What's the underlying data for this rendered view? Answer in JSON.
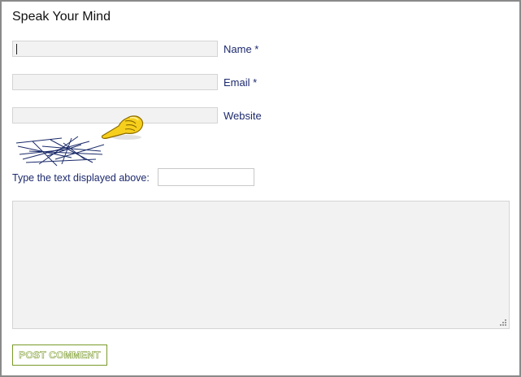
{
  "form": {
    "title": "Speak Your Mind",
    "fields": [
      {
        "label": "Name *",
        "value": ""
      },
      {
        "label": "Email *",
        "value": ""
      },
      {
        "label": "Website",
        "value": ""
      }
    ],
    "captcha": {
      "label": "Type the text displayed above:",
      "value": ""
    },
    "comment": {
      "value": ""
    },
    "submit_label": "POST COMMENT"
  },
  "icons": {
    "pointer": "pointing-hand-icon",
    "captcha": "captcha-image",
    "grip": "resize-grip-icon"
  },
  "colors": {
    "label_text": "#1d2a6e",
    "field_bg": "#f2f2f2",
    "button_border": "#7a9a2a"
  }
}
